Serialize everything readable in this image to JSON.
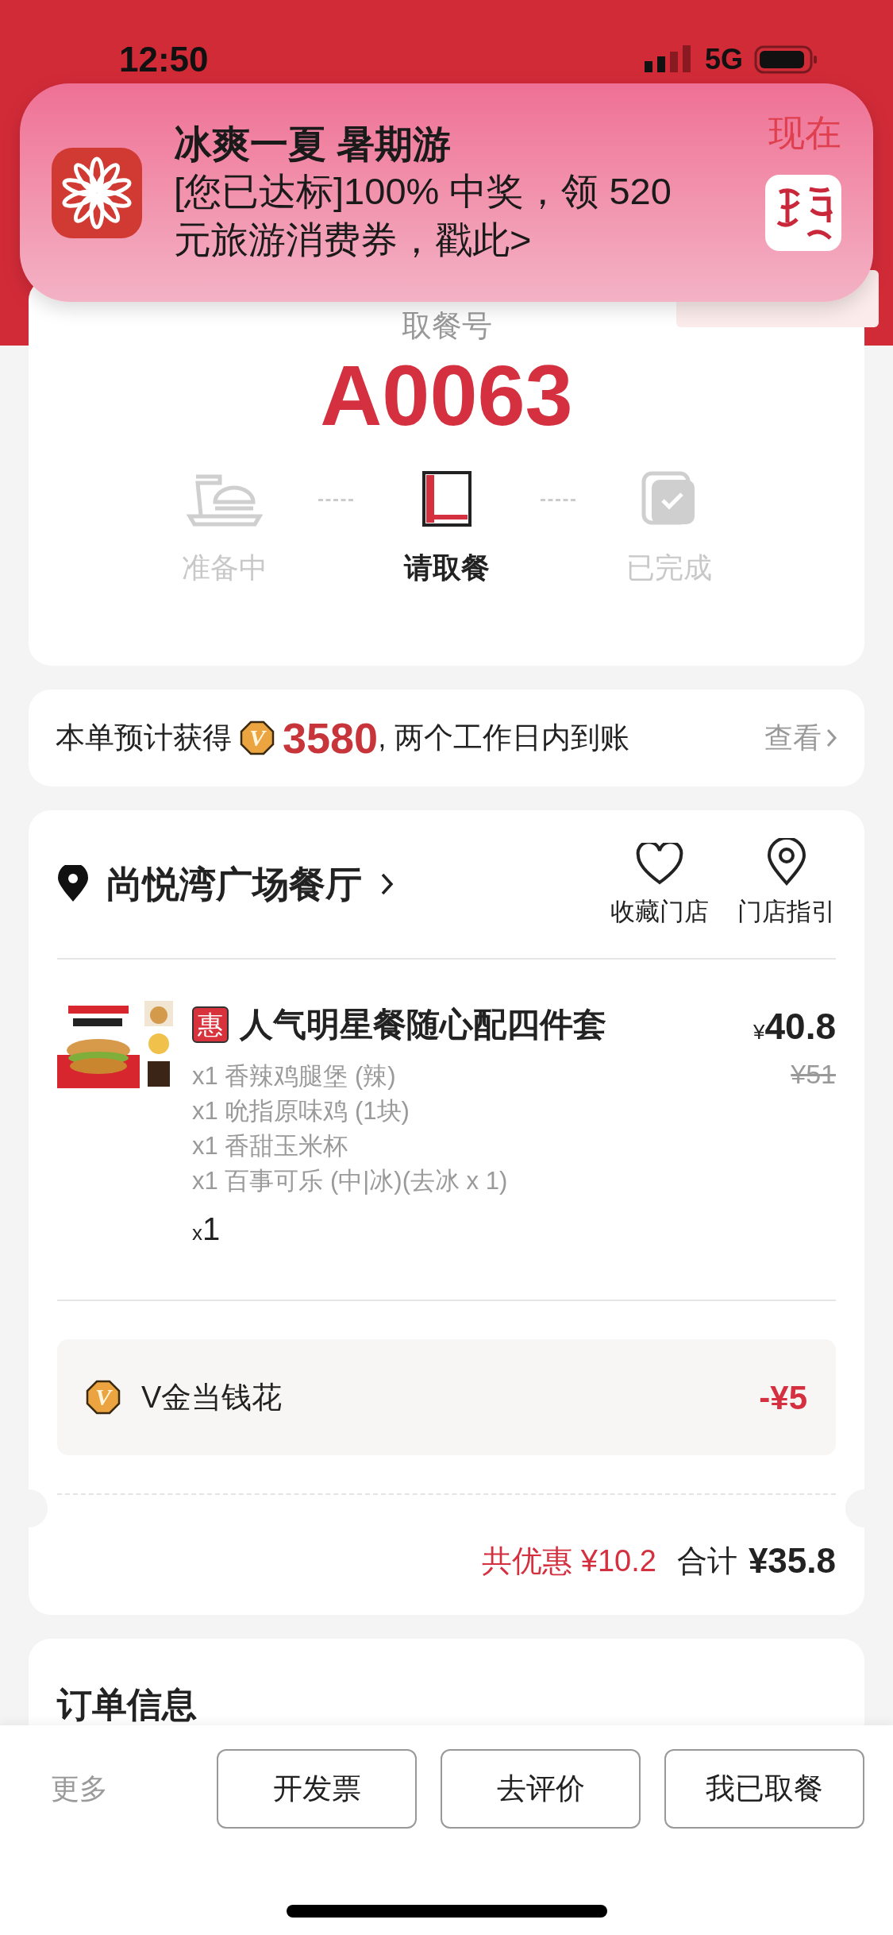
{
  "status_bar": {
    "time": "12:50",
    "network": "5G"
  },
  "notification": {
    "title": "冰爽一夏 暑期游",
    "body": "[您已达标]100% 中奖，领 520 元旅游消费券，戳此>",
    "time": "现在"
  },
  "pickup": {
    "label": "取餐号",
    "number": "A0063",
    "steps": [
      {
        "label": "准备中",
        "kind": "prepare",
        "selected": false
      },
      {
        "label": "请取餐",
        "kind": "pickup",
        "selected": true
      },
      {
        "label": "已完成",
        "kind": "done",
        "selected": false
      }
    ]
  },
  "points": {
    "prefix": "本单预计获得",
    "coin": "V",
    "amount": "3580",
    "suffix": ", 两个工作日内到账",
    "link": "查看"
  },
  "store": {
    "name": "尚悦湾广场餐厅",
    "actions": [
      {
        "label": "收藏门店",
        "kind": "favorite"
      },
      {
        "label": "门店指引",
        "kind": "guide"
      }
    ]
  },
  "item": {
    "badge": "惠",
    "name": "人气明星餐随心配四件套",
    "currency": "¥",
    "price": "40.8",
    "original_price": "¥51",
    "components": [
      "x1 香辣鸡腿堡 (辣)",
      "x1 吮指原味鸡 (1块)",
      "x1 香甜玉米杯",
      "x1 百事可乐 (中|冰)(去冰 x 1)"
    ],
    "quantity_prefix": "x",
    "quantity": "1"
  },
  "discount": {
    "coin": "V",
    "label": "V金当钱花",
    "amount": "-¥5"
  },
  "summary": {
    "savings": "共优惠 ¥10.2",
    "total_label": "合计",
    "total": "¥35.8"
  },
  "order_info": {
    "title": "订单信息"
  },
  "actions": {
    "more": "更多",
    "buttons": [
      "开发票",
      "去评价",
      "我已取餐"
    ]
  }
}
